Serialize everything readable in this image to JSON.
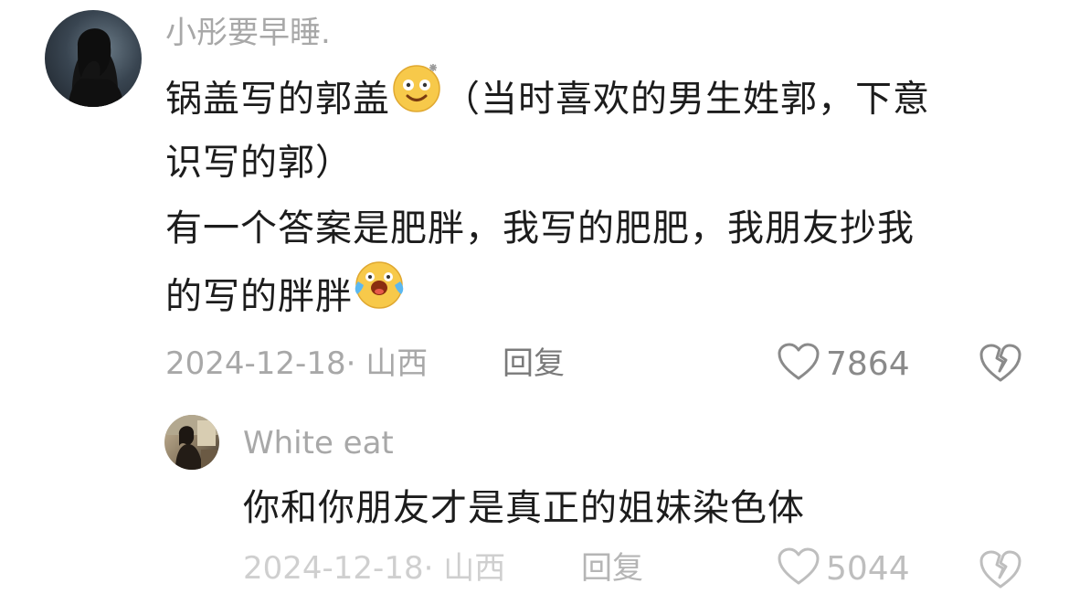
{
  "comments": [
    {
      "username": "小彤要早睡.",
      "lines": {
        "l1_a": "锅盖写的郭盖",
        "l1_b": "（当时喜欢的男生姓郭，下意",
        "l2": "识写的郭）",
        "l3": "有一个答案是肥胖，我写的肥肥，我朋友抄我",
        "l4": "的写的胖胖"
      },
      "emoji_1": "dizzy-smile-emoji",
      "emoji_2": "crying-laughing-emoji",
      "date_location": "2024-12-18· 山西",
      "reply_label": "回复",
      "like_count": "7864",
      "like_icon": "heart-outline-icon",
      "dislike_icon": "broken-heart-icon"
    },
    {
      "username": "White eat",
      "text": "你和你朋友才是真正的姐妹染色体",
      "date_location": "2024-12-18· 山西",
      "reply_label": "回复",
      "like_count": "5044",
      "like_icon": "heart-outline-icon",
      "dislike_icon": "broken-heart-icon"
    }
  ]
}
